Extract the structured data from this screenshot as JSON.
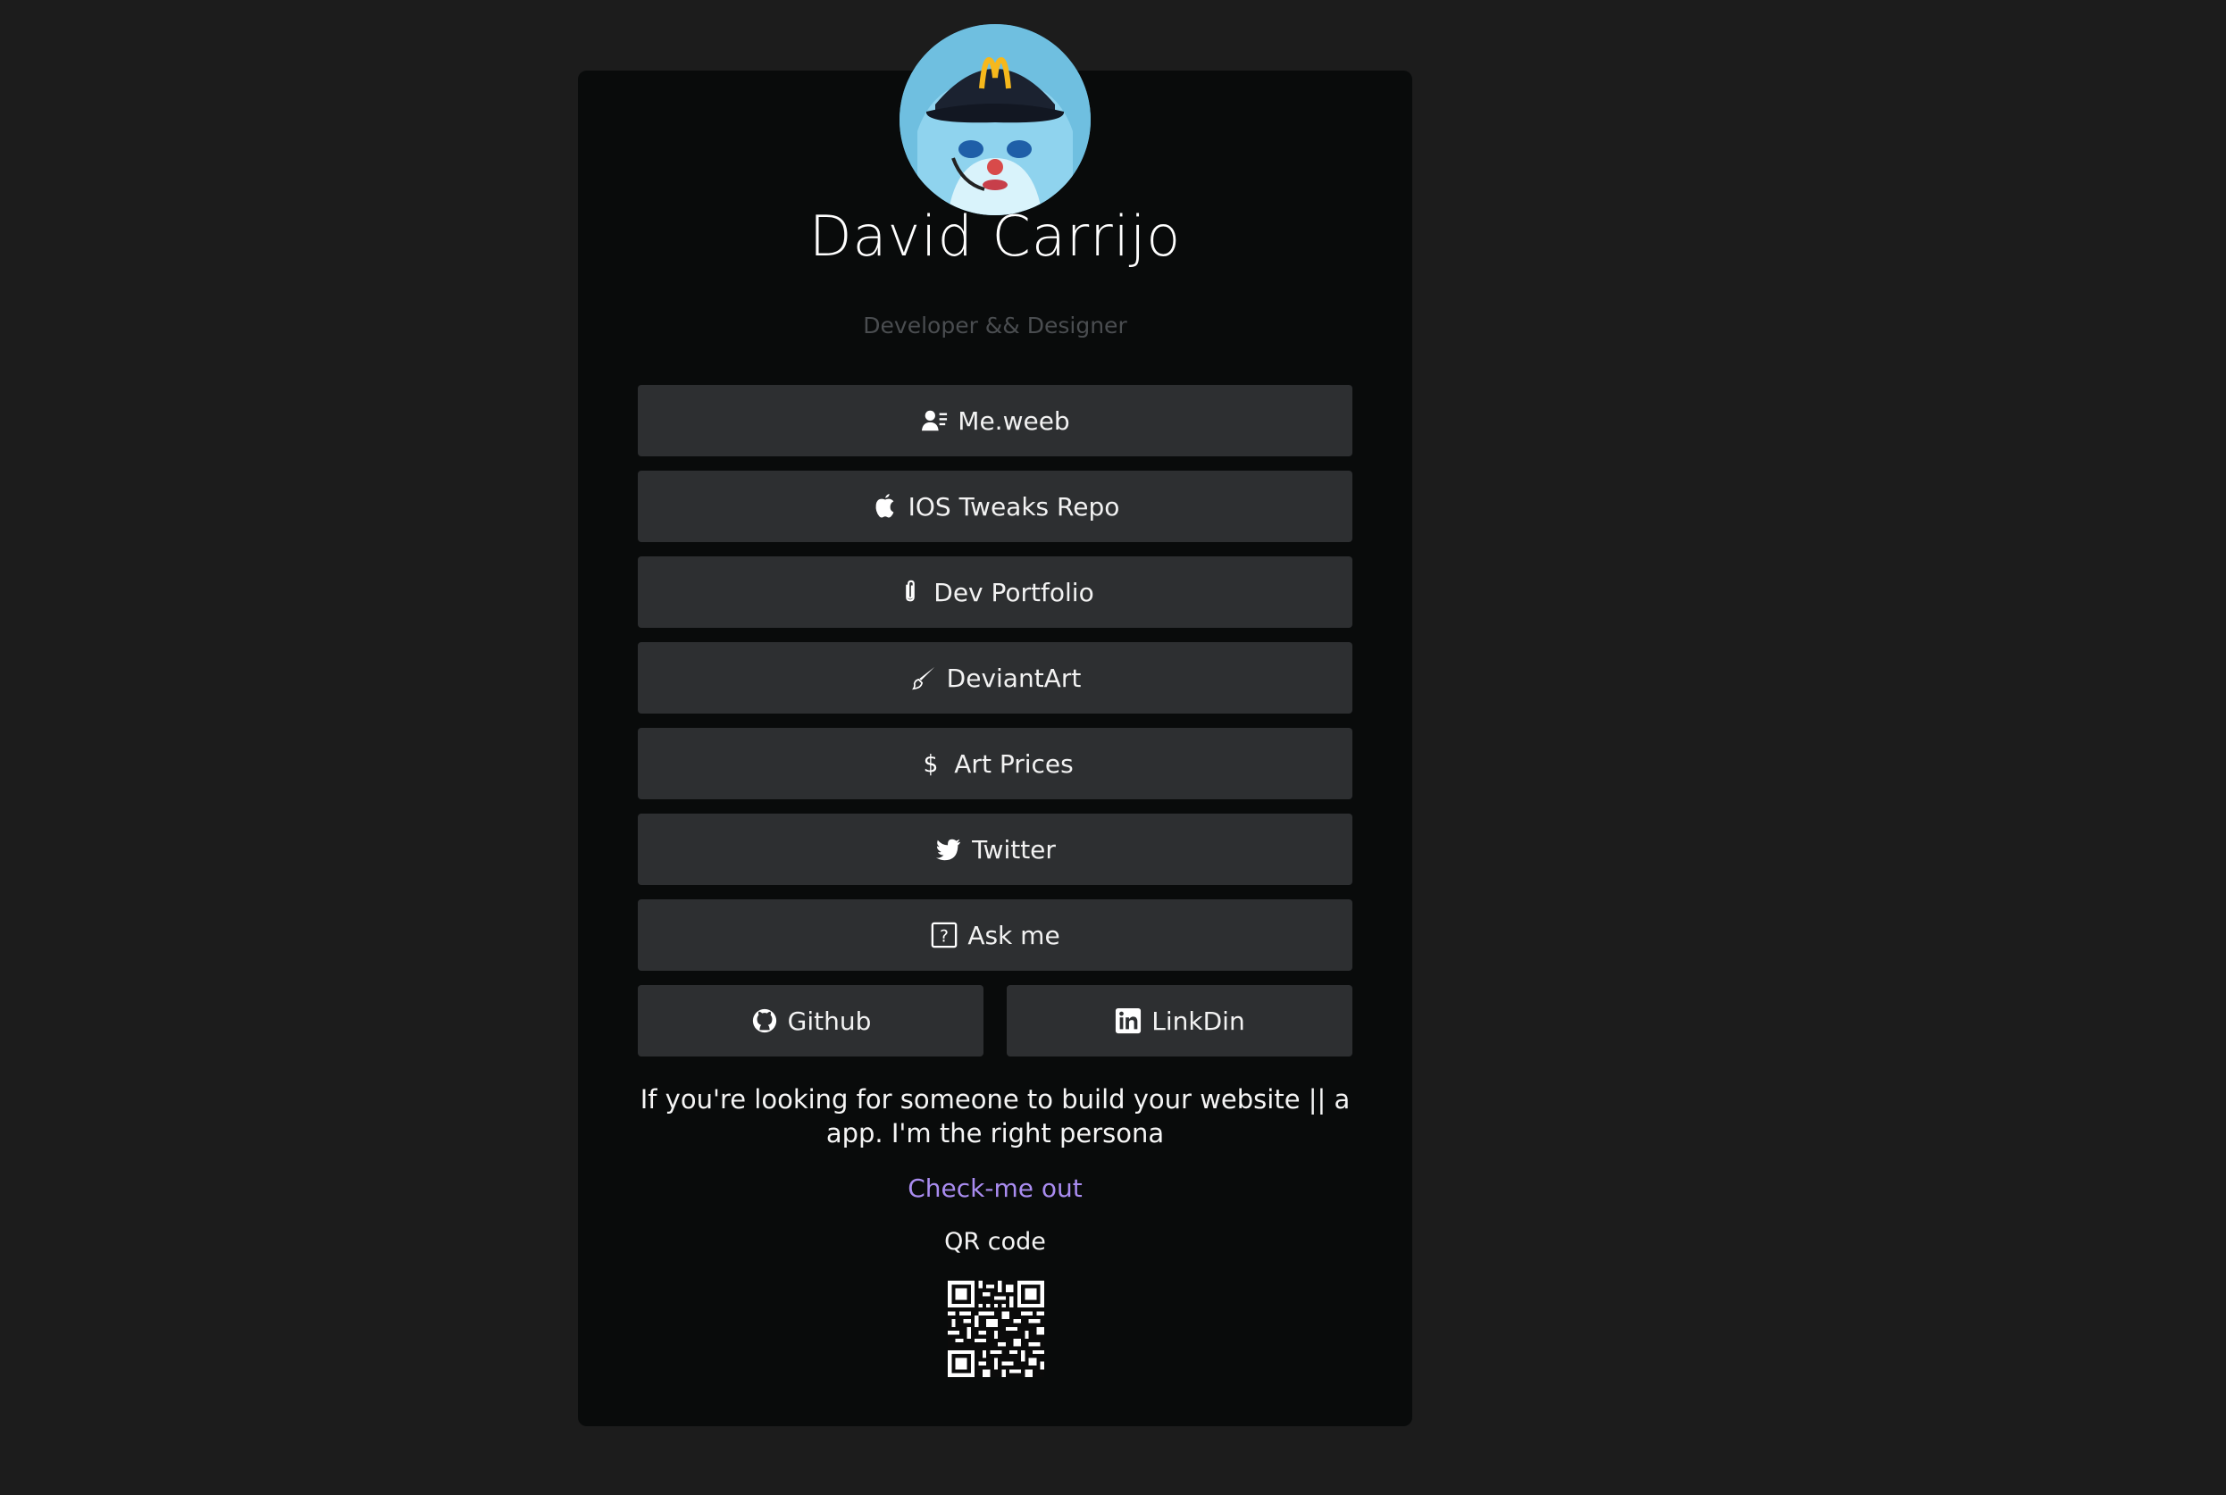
{
  "profile": {
    "name": "David Carrijo",
    "subtitle": "Developer && Designer",
    "avatar_icon": "avatar-mcdonalds-cap-anime-character"
  },
  "links": [
    {
      "label": "Me.weeb",
      "icon": "user-card-icon"
    },
    {
      "label": "IOS Tweaks Repo",
      "icon": "apple-icon"
    },
    {
      "label": "Dev Portfolio",
      "icon": "paperclip-icon"
    },
    {
      "label": "DeviantArt",
      "icon": "brush-icon"
    },
    {
      "label": "Art Prices",
      "icon": "dollar-icon"
    },
    {
      "label": "Twitter",
      "icon": "twitter-icon"
    },
    {
      "label": "Ask me",
      "icon": "question-box-icon"
    }
  ],
  "social": {
    "github": {
      "label": "Github",
      "icon": "github-icon"
    },
    "linkedin": {
      "label": "LinkDin",
      "icon": "linkedin-icon"
    }
  },
  "pitch": "If you're looking for someone to build your website || a app. I'm the right persona",
  "cta": "Check-me out",
  "qr_label": "QR code",
  "colors": {
    "background": "#1c1c1c",
    "card": "#090b0b",
    "button": "#2d2f31",
    "cta": "#a98cf0",
    "subtitle": "#4a4d50"
  }
}
